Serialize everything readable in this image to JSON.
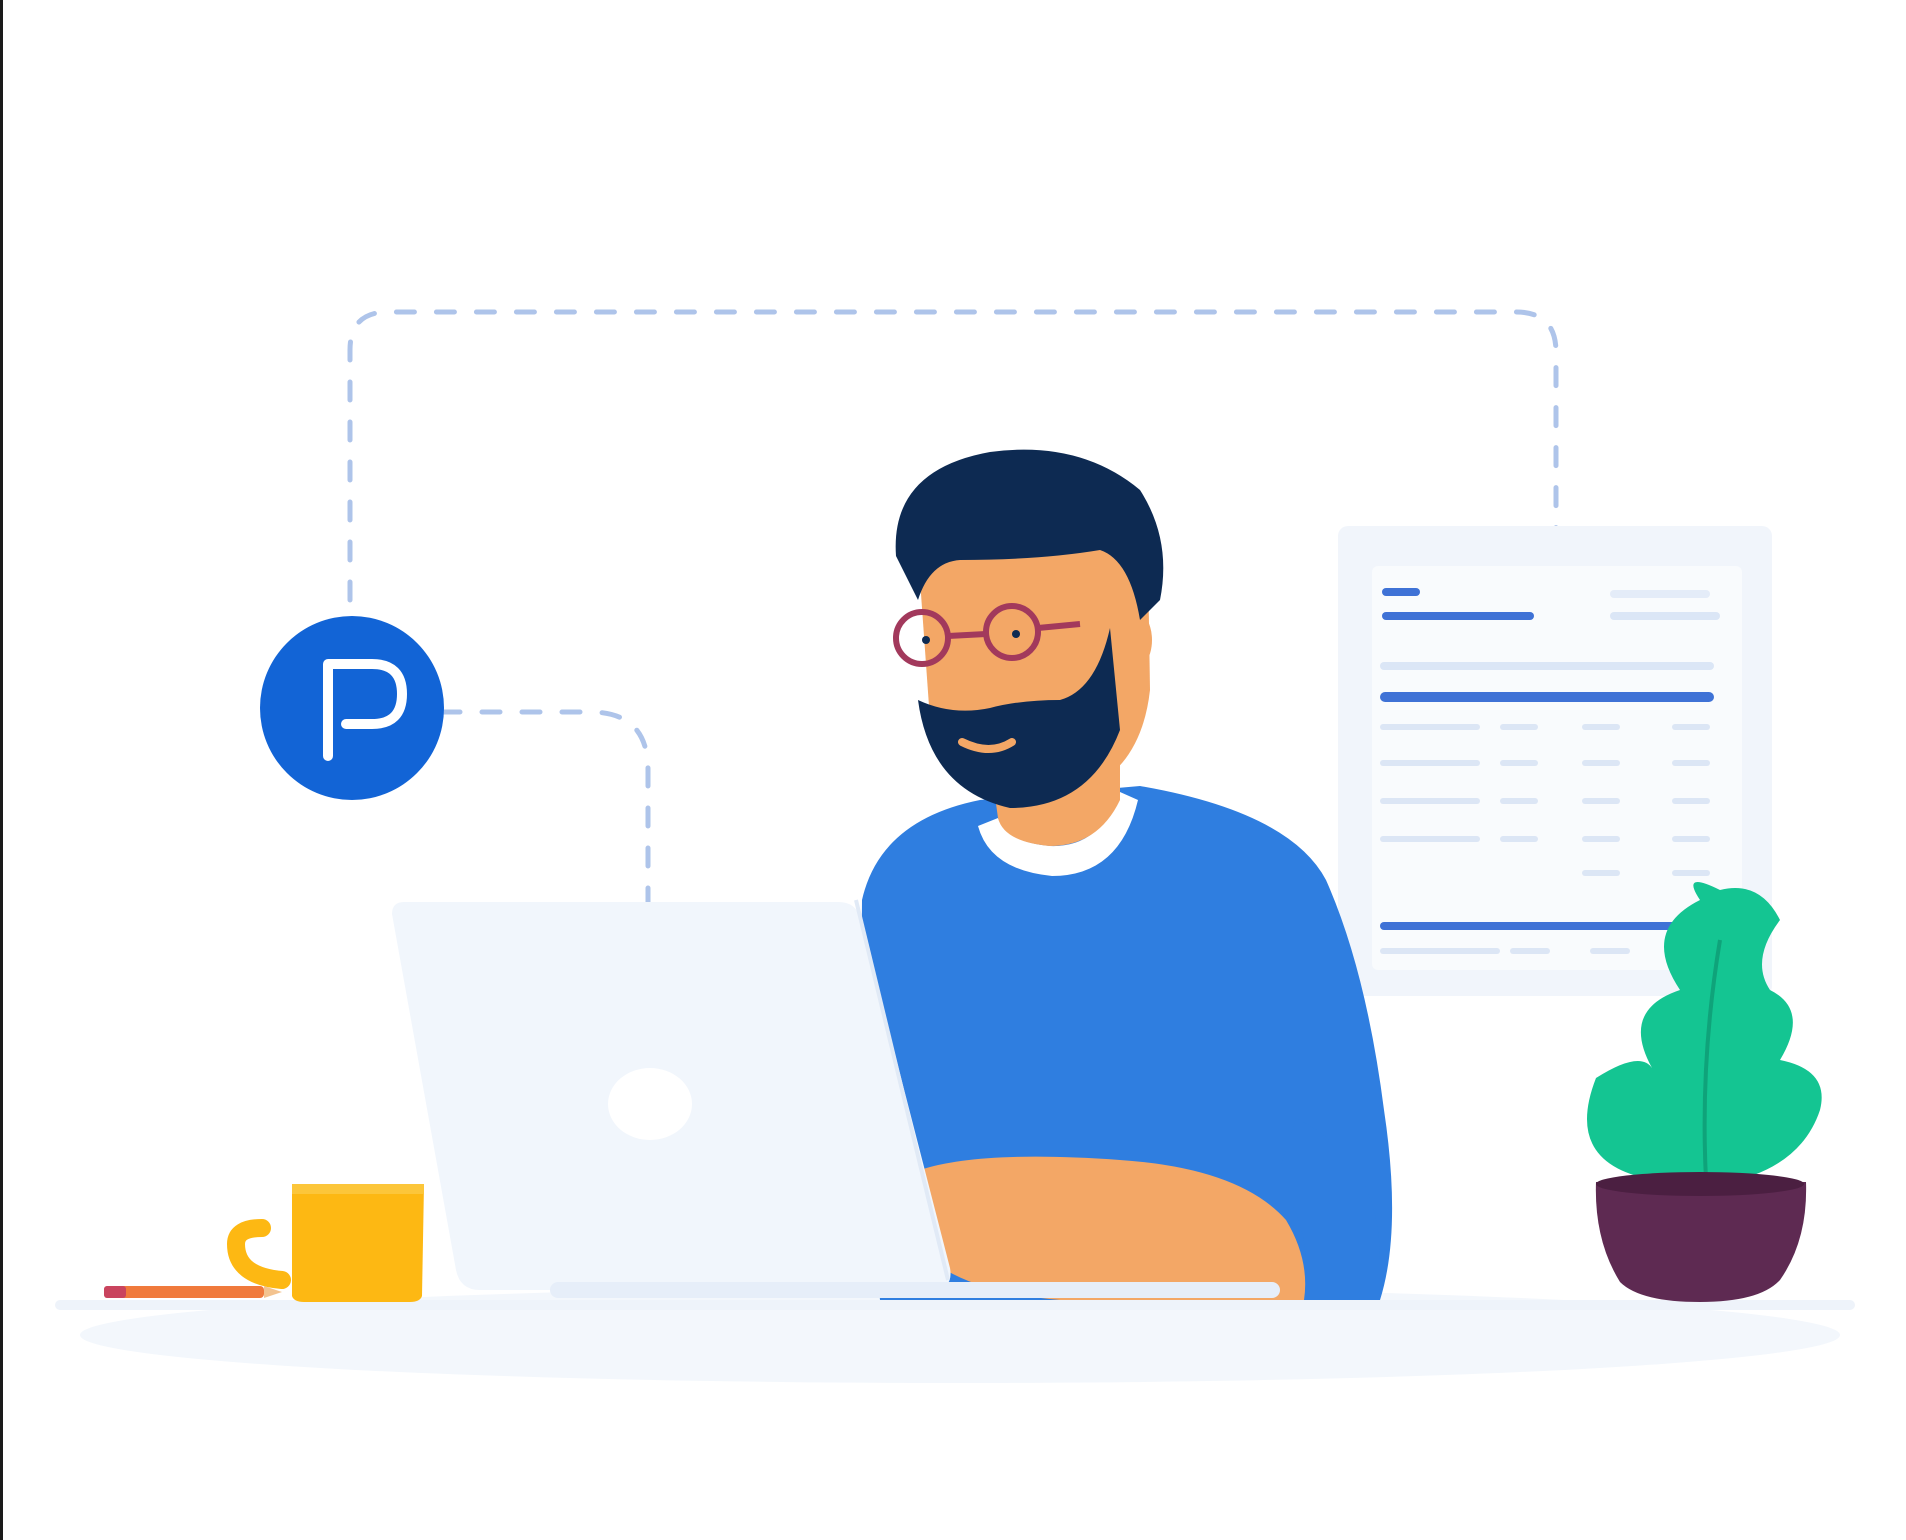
{
  "brand": {
    "logo_letter": "P",
    "primary_color": "#1264d6"
  },
  "illustration": {
    "sweater_color": "#2f7ee0",
    "hair_color": "#0d2a52",
    "skin_color": "#f3a766",
    "glasses_color": "#a2395c",
    "laptop_color": "#f1f6fc",
    "mug_color": "#fdb813",
    "plant_color": "#14c592",
    "pot_color": "#5e2a52",
    "pencil_color": "#f07a3c",
    "connector_line_color": "#aec4ea",
    "document_accent_color": "#3f72d6"
  }
}
